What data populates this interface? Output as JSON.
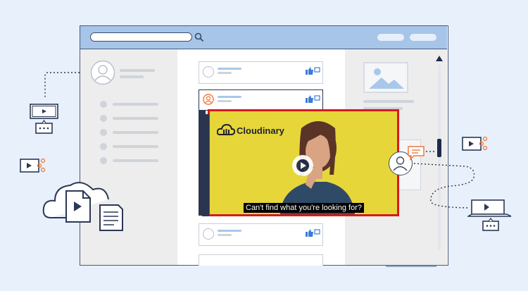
{
  "video": {
    "brand": "Cloudinary",
    "caption": "Can't find what you're looking for?"
  },
  "icons": [
    "search-icon",
    "user-avatar-icon",
    "image-placeholder-icon",
    "play-icon",
    "cloud-icon",
    "video-file-icon",
    "document-icon",
    "share-icon",
    "chat-bubble-icon",
    "thumbs-up-icon",
    "laptop-icon",
    "more-icon",
    "scroll-up-arrow-icon"
  ],
  "colors": {
    "background": "#e8f0fb",
    "titlebar": "#a6c5e8",
    "outline": "#3b4a66",
    "accent_red": "#d71a1a",
    "accent_orange": "#f07a3a",
    "video_bg": "#e6d63a",
    "panel_gray": "#ededed"
  }
}
